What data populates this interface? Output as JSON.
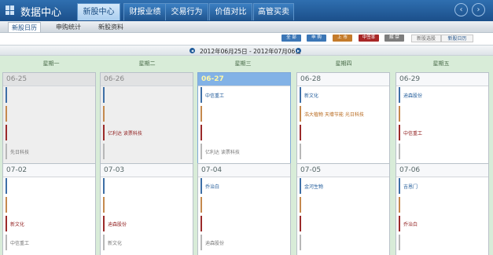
{
  "app": {
    "title": "数据中心"
  },
  "main_tabs": [
    {
      "label": "新股中心"
    },
    {
      "label": "财报业绩"
    },
    {
      "label": "交易行为"
    },
    {
      "label": "价值对比"
    },
    {
      "label": "高管买卖"
    }
  ],
  "nav": {
    "back": "‹",
    "forward": "›"
  },
  "sub_tabs": [
    {
      "label": "新股日历"
    },
    {
      "label": "申购统计"
    },
    {
      "label": "新股资料"
    }
  ],
  "legend": {
    "all": "全 部",
    "subscribe": "申 购",
    "listing": "上 市",
    "meeting": "中签率",
    "unlock": "解 禁",
    "prev_calendar": "新股选股",
    "new_calendar": "新股日历"
  },
  "colors": {
    "all": "#3b76b6",
    "subscribe": "#3b76b6",
    "listing": "#c47b2b",
    "meeting": "#a82727",
    "unlock": "#7d7d7d"
  },
  "range": {
    "text": "2012年06月25日 - 2012年07月06日",
    "prev": "◀",
    "next": "▶"
  },
  "weekdays": [
    "星期一",
    "星期二",
    "星期三",
    "星期四",
    "星期五"
  ],
  "weeks": [
    [
      {
        "date": "06-25",
        "sub": "",
        "list": "",
        "meet": "",
        "unlock": "先日科技"
      },
      {
        "date": "06-26",
        "sub": "",
        "list": "",
        "meet": "亿利达  读票科技",
        "unlock": ""
      },
      {
        "date": "06-27",
        "sub": "中信重工",
        "list": "",
        "meet": "",
        "unlock": "亿利达  读票科技"
      },
      {
        "date": "06-28",
        "sub": "新文化",
        "list": "浩大植物  天壕节能  光日科技",
        "meet": "",
        "unlock": ""
      },
      {
        "date": "06-29",
        "sub": "迪森股份",
        "list": "",
        "meet": "中信重工",
        "unlock": ""
      }
    ],
    [
      {
        "date": "07-02",
        "sub": "",
        "list": "",
        "meet": "新文化",
        "unlock": "中信重工"
      },
      {
        "date": "07-03",
        "sub": "",
        "list": "",
        "meet": "迪森股份",
        "unlock": "新文化"
      },
      {
        "date": "07-04",
        "sub": "乔治白",
        "list": "",
        "meet": "",
        "unlock": "迪森股份"
      },
      {
        "date": "07-05",
        "sub": "金河生物",
        "list": "",
        "meet": "",
        "unlock": ""
      },
      {
        "date": "07-06",
        "sub": "吉恩门",
        "list": "",
        "meet": "乔治白",
        "unlock": ""
      }
    ]
  ]
}
